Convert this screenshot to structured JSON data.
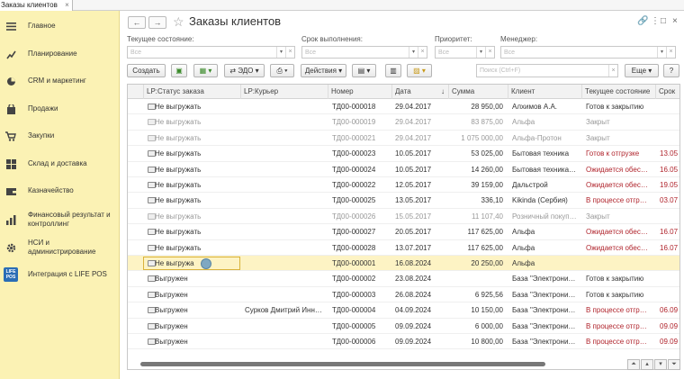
{
  "window": {
    "tab_title": "Заказы клиентов",
    "tab_close": "×"
  },
  "sidebar": {
    "items": [
      {
        "label": "Главное",
        "icon": "menu-icon"
      },
      {
        "label": "Планирование",
        "icon": "planning-icon"
      },
      {
        "label": "CRM и маркетинг",
        "icon": "crm-icon"
      },
      {
        "label": "Продажи",
        "icon": "sales-icon"
      },
      {
        "label": "Закупки",
        "icon": "purchases-icon"
      },
      {
        "label": "Склад и доставка",
        "icon": "warehouse-icon"
      },
      {
        "label": "Казначейство",
        "icon": "treasury-icon"
      },
      {
        "label": "Финансовый результат и контроллинг",
        "icon": "finance-icon"
      },
      {
        "label": "НСИ и администрирование",
        "icon": "gear-icon"
      },
      {
        "label": "Интеграция с LIFE POS",
        "icon": "lifepos-logo"
      }
    ],
    "logo_text": "LIFE POS"
  },
  "header": {
    "back": "←",
    "forward": "→",
    "star": "☆",
    "title": "Заказы клиентов",
    "link": "🔗",
    "more": "⋮",
    "restore": "□",
    "close": "×"
  },
  "filters": {
    "state": {
      "label": "Текущее состояние:",
      "placeholder": "Все"
    },
    "deadline": {
      "label": "Срок выполнения:",
      "placeholder": "Все"
    },
    "priority": {
      "label": "Приоритет:",
      "placeholder": "Все"
    },
    "manager": {
      "label": "Менеджер:",
      "placeholder": "Все"
    }
  },
  "toolbar": {
    "create": "Создать",
    "edo": "ЭДО",
    "actions": "Действия",
    "search_placeholder": "Поиск (Ctrl+F)",
    "more": "Еще"
  },
  "table": {
    "headers": [
      "LP:Статус заказа",
      "LP:Курьер",
      "Номер",
      "Дата",
      "Сумма",
      "Клиент",
      "Текущее состояние",
      "Срок"
    ],
    "rows": [
      {
        "status": "Не выгружать",
        "courier": "",
        "number": "ТД00-000018",
        "date": "29.04.2017",
        "sum": "28 950,00",
        "client": "Алхимов А.А.",
        "state": "Готов к закрытию",
        "deadline": "",
        "gray": false,
        "red": false
      },
      {
        "status": "Не выгружать",
        "courier": "",
        "number": "ТД00-000019",
        "date": "29.04.2017",
        "sum": "83 875,00",
        "client": "Альфа",
        "state": "Закрыт",
        "deadline": "",
        "gray": true,
        "red": false
      },
      {
        "status": "Не выгружать",
        "courier": "",
        "number": "ТД00-000021",
        "date": "29.04.2017",
        "sum": "1 075 000,00",
        "client": "Альфа-Протон",
        "state": "Закрыт",
        "deadline": "",
        "gray": true,
        "red": false
      },
      {
        "status": "Не выгружать",
        "courier": "",
        "number": "ТД00-000023",
        "date": "10.05.2017",
        "sum": "53 025,00",
        "client": "Бытовая техника",
        "state": "Готов к отгрузке",
        "deadline": "13.05",
        "gray": false,
        "red": true
      },
      {
        "status": "Не выгружать",
        "courier": "",
        "number": "ТД00-000024",
        "date": "10.05.2017",
        "sum": "14 260,00",
        "client": "Бытовая техника…",
        "state": "Ожидается обес…",
        "deadline": "16.05",
        "gray": false,
        "red": true
      },
      {
        "status": "Не выгружать",
        "courier": "",
        "number": "ТД00-000022",
        "date": "12.05.2017",
        "sum": "39 159,00",
        "client": "Дальстрой",
        "state": "Ожидается обес…",
        "deadline": "19.05",
        "gray": false,
        "red": true
      },
      {
        "status": "Не выгружать",
        "courier": "",
        "number": "ТД00-000025",
        "date": "13.05.2017",
        "sum": "336,10",
        "client": "Kikinda (Сербия)",
        "state": "В процессе отгр…",
        "deadline": "03.07",
        "gray": false,
        "red": true
      },
      {
        "status": "Не выгружать",
        "courier": "",
        "number": "ТД00-000026",
        "date": "15.05.2017",
        "sum": "11 107,40",
        "client": "Розничный покуп…",
        "state": "Закрыт",
        "deadline": "",
        "gray": true,
        "red": false
      },
      {
        "status": "Не выгружать",
        "courier": "",
        "number": "ТД00-000027",
        "date": "20.05.2017",
        "sum": "117 625,00",
        "client": "Альфа",
        "state": "Ожидается обес…",
        "deadline": "16.07",
        "gray": false,
        "red": true
      },
      {
        "status": "Не выгружать",
        "courier": "",
        "number": "ТД00-000028",
        "date": "13.07.2017",
        "sum": "117 625,00",
        "client": "Альфа",
        "state": "Ожидается обес…",
        "deadline": "16.07",
        "gray": false,
        "red": true
      },
      {
        "status": "Не выгружа",
        "courier": "",
        "number": "ТД00-000001",
        "date": "16.08.2024",
        "sum": "20 250,00",
        "client": "Альфа",
        "state": "",
        "deadline": "",
        "gray": false,
        "red": false,
        "selected": true
      },
      {
        "status": "Выгружен",
        "courier": "",
        "number": "ТД00-000002",
        "date": "23.08.2024",
        "sum": "",
        "client": "База \"Электрони…",
        "state": "Готов к закрытию",
        "deadline": "",
        "gray": false,
        "red": false
      },
      {
        "status": "Выгружен",
        "courier": "",
        "number": "ТД00-000003",
        "date": "26.08.2024",
        "sum": "6 925,56",
        "client": "База \"Электрони…",
        "state": "Готов к закрытию",
        "deadline": "",
        "gray": false,
        "red": false
      },
      {
        "status": "Выгружен",
        "courier": "Сурков Дмитрий Инн…",
        "number": "ТД00-000004",
        "date": "04.09.2024",
        "sum": "10 150,00",
        "client": "База \"Электрони…",
        "state": "В процессе отгр…",
        "deadline": "06.09",
        "gray": false,
        "red": true
      },
      {
        "status": "Выгружен",
        "courier": "",
        "number": "ТД00-000005",
        "date": "09.09.2024",
        "sum": "6 000,00",
        "client": "База \"Электрони…",
        "state": "В процессе отгр…",
        "deadline": "09.09",
        "gray": false,
        "red": true
      },
      {
        "status": "Выгружен",
        "courier": "",
        "number": "ТД00-000006",
        "date": "09.09.2024",
        "sum": "10 800,00",
        "client": "База \"Электрони…",
        "state": "В процессе отгр…",
        "deadline": "09.09",
        "gray": false,
        "red": true
      }
    ]
  },
  "colors": {
    "sidebar_bg": "#fbf2b4",
    "selected_row": "#fdf3c4",
    "overdue_red": "#b0242c",
    "accent_green": "#3a8a2a"
  }
}
